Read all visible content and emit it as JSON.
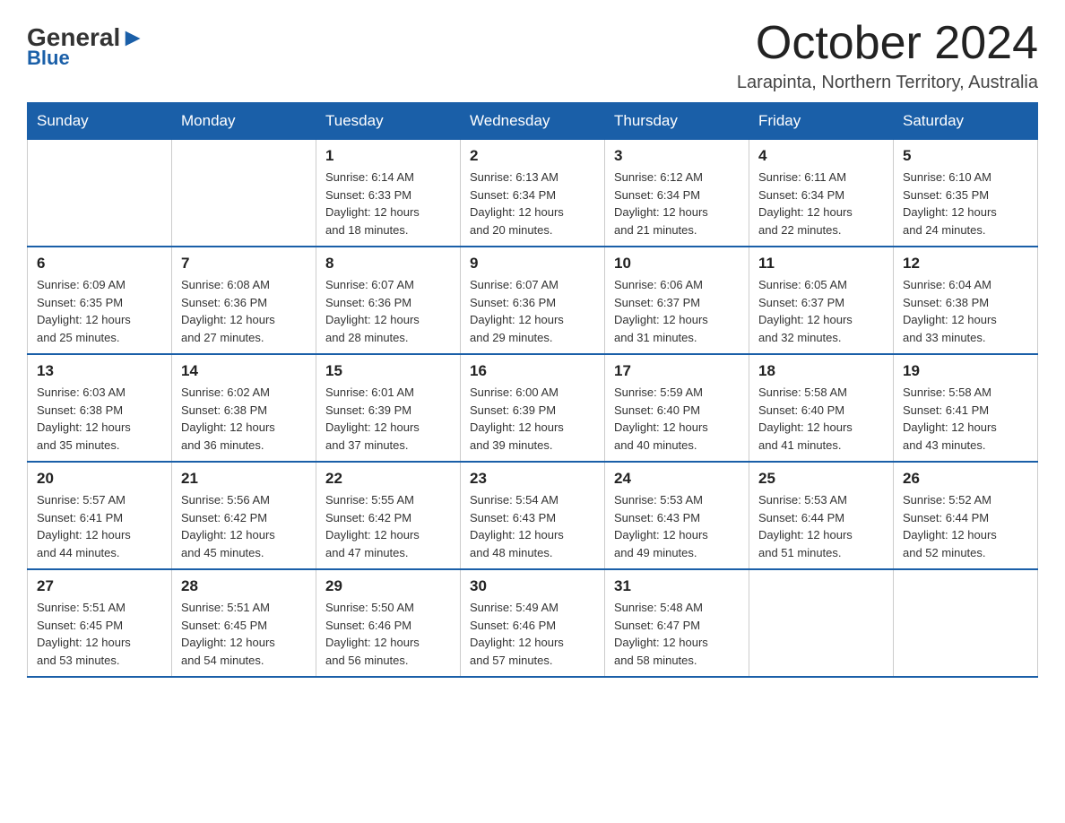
{
  "header": {
    "logo_general": "General",
    "logo_blue": "Blue",
    "title": "October 2024",
    "subtitle": "Larapinta, Northern Territory, Australia"
  },
  "days_of_week": [
    "Sunday",
    "Monday",
    "Tuesday",
    "Wednesday",
    "Thursday",
    "Friday",
    "Saturday"
  ],
  "weeks": [
    {
      "days": [
        {
          "num": "",
          "info": ""
        },
        {
          "num": "",
          "info": ""
        },
        {
          "num": "1",
          "info": "Sunrise: 6:14 AM\nSunset: 6:33 PM\nDaylight: 12 hours\nand 18 minutes."
        },
        {
          "num": "2",
          "info": "Sunrise: 6:13 AM\nSunset: 6:34 PM\nDaylight: 12 hours\nand 20 minutes."
        },
        {
          "num": "3",
          "info": "Sunrise: 6:12 AM\nSunset: 6:34 PM\nDaylight: 12 hours\nand 21 minutes."
        },
        {
          "num": "4",
          "info": "Sunrise: 6:11 AM\nSunset: 6:34 PM\nDaylight: 12 hours\nand 22 minutes."
        },
        {
          "num": "5",
          "info": "Sunrise: 6:10 AM\nSunset: 6:35 PM\nDaylight: 12 hours\nand 24 minutes."
        }
      ]
    },
    {
      "days": [
        {
          "num": "6",
          "info": "Sunrise: 6:09 AM\nSunset: 6:35 PM\nDaylight: 12 hours\nand 25 minutes."
        },
        {
          "num": "7",
          "info": "Sunrise: 6:08 AM\nSunset: 6:36 PM\nDaylight: 12 hours\nand 27 minutes."
        },
        {
          "num": "8",
          "info": "Sunrise: 6:07 AM\nSunset: 6:36 PM\nDaylight: 12 hours\nand 28 minutes."
        },
        {
          "num": "9",
          "info": "Sunrise: 6:07 AM\nSunset: 6:36 PM\nDaylight: 12 hours\nand 29 minutes."
        },
        {
          "num": "10",
          "info": "Sunrise: 6:06 AM\nSunset: 6:37 PM\nDaylight: 12 hours\nand 31 minutes."
        },
        {
          "num": "11",
          "info": "Sunrise: 6:05 AM\nSunset: 6:37 PM\nDaylight: 12 hours\nand 32 minutes."
        },
        {
          "num": "12",
          "info": "Sunrise: 6:04 AM\nSunset: 6:38 PM\nDaylight: 12 hours\nand 33 minutes."
        }
      ]
    },
    {
      "days": [
        {
          "num": "13",
          "info": "Sunrise: 6:03 AM\nSunset: 6:38 PM\nDaylight: 12 hours\nand 35 minutes."
        },
        {
          "num": "14",
          "info": "Sunrise: 6:02 AM\nSunset: 6:38 PM\nDaylight: 12 hours\nand 36 minutes."
        },
        {
          "num": "15",
          "info": "Sunrise: 6:01 AM\nSunset: 6:39 PM\nDaylight: 12 hours\nand 37 minutes."
        },
        {
          "num": "16",
          "info": "Sunrise: 6:00 AM\nSunset: 6:39 PM\nDaylight: 12 hours\nand 39 minutes."
        },
        {
          "num": "17",
          "info": "Sunrise: 5:59 AM\nSunset: 6:40 PM\nDaylight: 12 hours\nand 40 minutes."
        },
        {
          "num": "18",
          "info": "Sunrise: 5:58 AM\nSunset: 6:40 PM\nDaylight: 12 hours\nand 41 minutes."
        },
        {
          "num": "19",
          "info": "Sunrise: 5:58 AM\nSunset: 6:41 PM\nDaylight: 12 hours\nand 43 minutes."
        }
      ]
    },
    {
      "days": [
        {
          "num": "20",
          "info": "Sunrise: 5:57 AM\nSunset: 6:41 PM\nDaylight: 12 hours\nand 44 minutes."
        },
        {
          "num": "21",
          "info": "Sunrise: 5:56 AM\nSunset: 6:42 PM\nDaylight: 12 hours\nand 45 minutes."
        },
        {
          "num": "22",
          "info": "Sunrise: 5:55 AM\nSunset: 6:42 PM\nDaylight: 12 hours\nand 47 minutes."
        },
        {
          "num": "23",
          "info": "Sunrise: 5:54 AM\nSunset: 6:43 PM\nDaylight: 12 hours\nand 48 minutes."
        },
        {
          "num": "24",
          "info": "Sunrise: 5:53 AM\nSunset: 6:43 PM\nDaylight: 12 hours\nand 49 minutes."
        },
        {
          "num": "25",
          "info": "Sunrise: 5:53 AM\nSunset: 6:44 PM\nDaylight: 12 hours\nand 51 minutes."
        },
        {
          "num": "26",
          "info": "Sunrise: 5:52 AM\nSunset: 6:44 PM\nDaylight: 12 hours\nand 52 minutes."
        }
      ]
    },
    {
      "days": [
        {
          "num": "27",
          "info": "Sunrise: 5:51 AM\nSunset: 6:45 PM\nDaylight: 12 hours\nand 53 minutes."
        },
        {
          "num": "28",
          "info": "Sunrise: 5:51 AM\nSunset: 6:45 PM\nDaylight: 12 hours\nand 54 minutes."
        },
        {
          "num": "29",
          "info": "Sunrise: 5:50 AM\nSunset: 6:46 PM\nDaylight: 12 hours\nand 56 minutes."
        },
        {
          "num": "30",
          "info": "Sunrise: 5:49 AM\nSunset: 6:46 PM\nDaylight: 12 hours\nand 57 minutes."
        },
        {
          "num": "31",
          "info": "Sunrise: 5:48 AM\nSunset: 6:47 PM\nDaylight: 12 hours\nand 58 minutes."
        },
        {
          "num": "",
          "info": ""
        },
        {
          "num": "",
          "info": ""
        }
      ]
    }
  ]
}
